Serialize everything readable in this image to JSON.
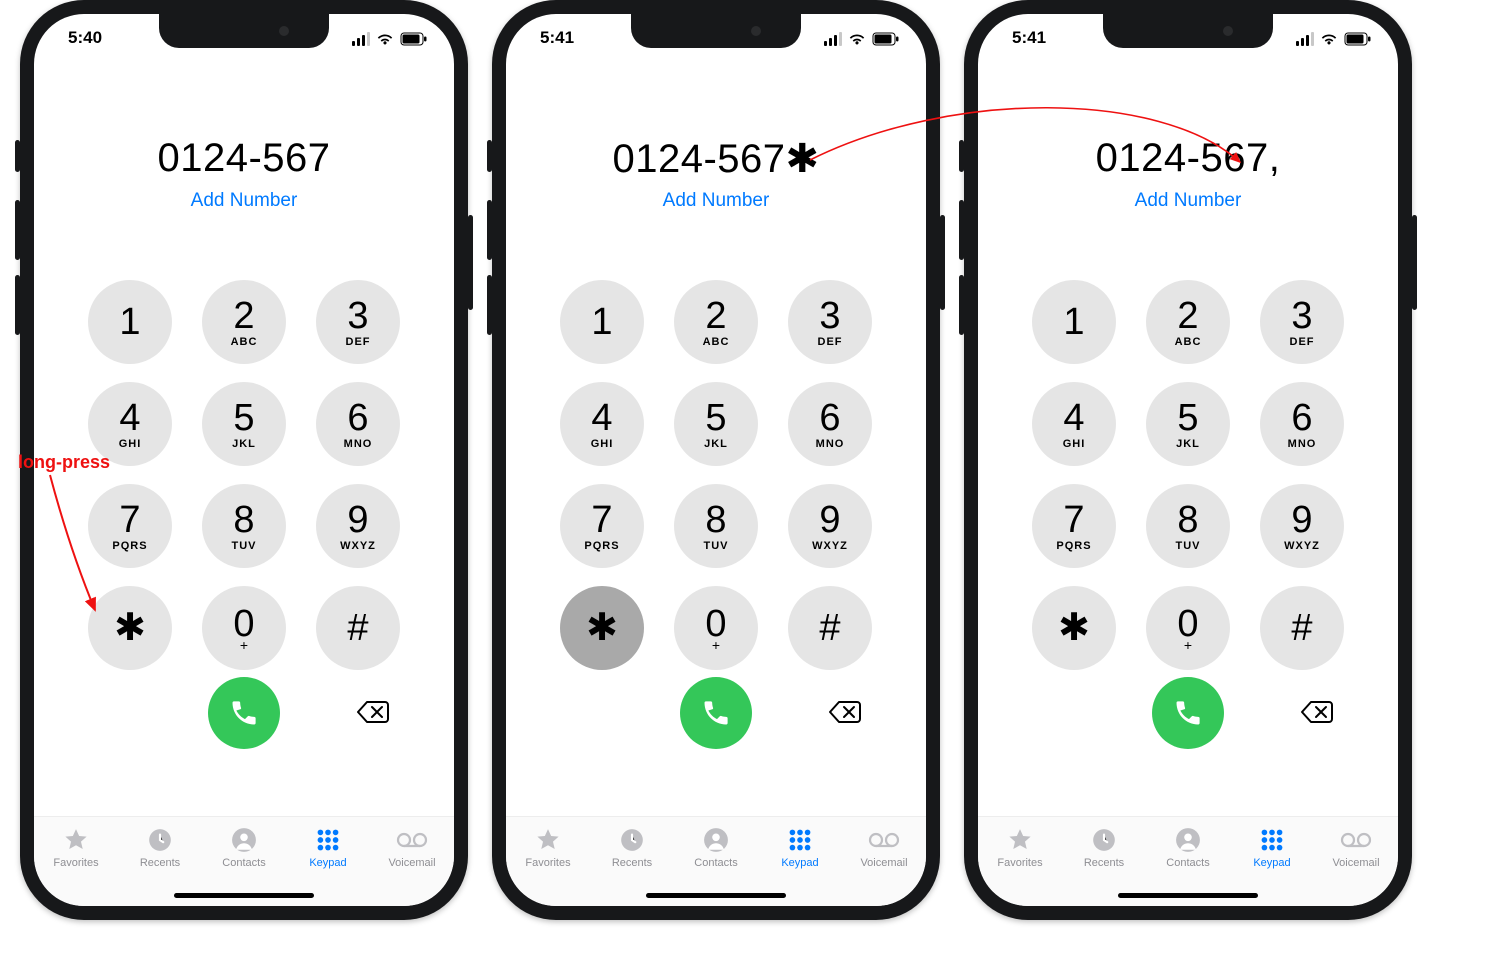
{
  "annotation": {
    "long_press": "long-press"
  },
  "colors": {
    "link": "#007aff",
    "call_green": "#34c759",
    "key_bg": "#e5e5e5",
    "key_pressed": "#a9a9a9",
    "anno_red": "#e11"
  },
  "keypad": {
    "keys": [
      {
        "digit": "1",
        "letters": ""
      },
      {
        "digit": "2",
        "letters": "ABC"
      },
      {
        "digit": "3",
        "letters": "DEF"
      },
      {
        "digit": "4",
        "letters": "GHI"
      },
      {
        "digit": "5",
        "letters": "JKL"
      },
      {
        "digit": "6",
        "letters": "MNO"
      },
      {
        "digit": "7",
        "letters": "PQRS"
      },
      {
        "digit": "8",
        "letters": "TUV"
      },
      {
        "digit": "9",
        "letters": "WXYZ"
      },
      {
        "digit": "✱",
        "letters": ""
      },
      {
        "digit": "0",
        "letters": "+"
      },
      {
        "digit": "#",
        "letters": ""
      }
    ]
  },
  "tabbar": {
    "items": [
      {
        "label": "Favorites",
        "icon": "star-icon",
        "active": false
      },
      {
        "label": "Recents",
        "icon": "clock-icon",
        "active": false
      },
      {
        "label": "Contacts",
        "icon": "person-icon",
        "active": false
      },
      {
        "label": "Keypad",
        "icon": "keypad-icon",
        "active": true
      },
      {
        "label": "Voicemail",
        "icon": "voicemail-icon",
        "active": false
      }
    ]
  },
  "phones": [
    {
      "status_time": "5:40",
      "dialed": "0124-567",
      "add_number": "Add Number",
      "pressed_key_index": null
    },
    {
      "status_time": "5:41",
      "dialed": "0124-567✱",
      "add_number": "Add Number",
      "pressed_key_index": 9
    },
    {
      "status_time": "5:41",
      "dialed": "0124-567,",
      "add_number": "Add Number",
      "pressed_key_index": null
    }
  ]
}
